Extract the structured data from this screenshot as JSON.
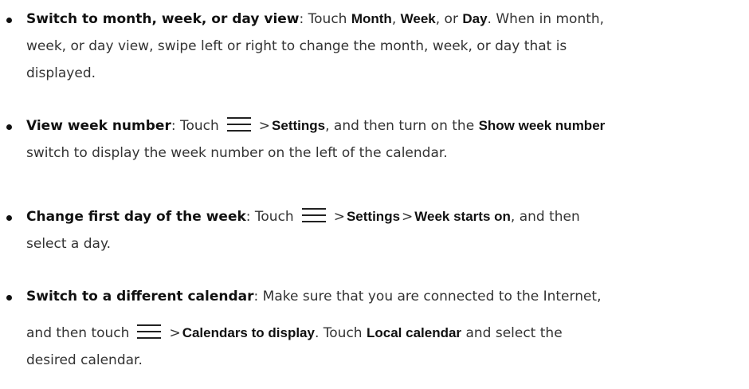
{
  "items": [
    {
      "title": "Switch to month, week, or day view",
      "body": {
        "t1": ": Touch ",
        "month": "Month",
        "t2": ", ",
        "week": "Week",
        "t3": ", or ",
        "day": "Day",
        "t4": ". When in month,",
        "line2": "week, or day view, swipe left or right to change the month, week, or day that is",
        "line3": "displayed."
      }
    },
    {
      "title": "View week number",
      "body": {
        "t1": ": Touch",
        "icon": "menu-icon",
        "sep": ">",
        "settings": "Settings",
        "t2": ", and then turn on the ",
        "show_week_number": "Show week number",
        "line2": "switch to display the week number on the left of the calendar."
      }
    },
    {
      "title": "Change first day of the week",
      "body": {
        "t1": ": Touch",
        "icon": "menu-icon",
        "sep1": ">",
        "settings": "Settings",
        "sep2": ">",
        "week_starts_on": "Week starts on",
        "t2": ", and then",
        "line2": "select a day."
      }
    },
    {
      "title": "Switch to a different calendar",
      "body": {
        "t1": ": Make sure that you are connected to the Internet,",
        "line2_a": "and then touch",
        "icon": "menu-icon",
        "sep": ">",
        "calendars_to_display": "Calendars to display",
        "t2": ". Touch ",
        "local_calendar": "Local calendar",
        "t3": " and select the",
        "line3": "desired calendar."
      }
    }
  ]
}
